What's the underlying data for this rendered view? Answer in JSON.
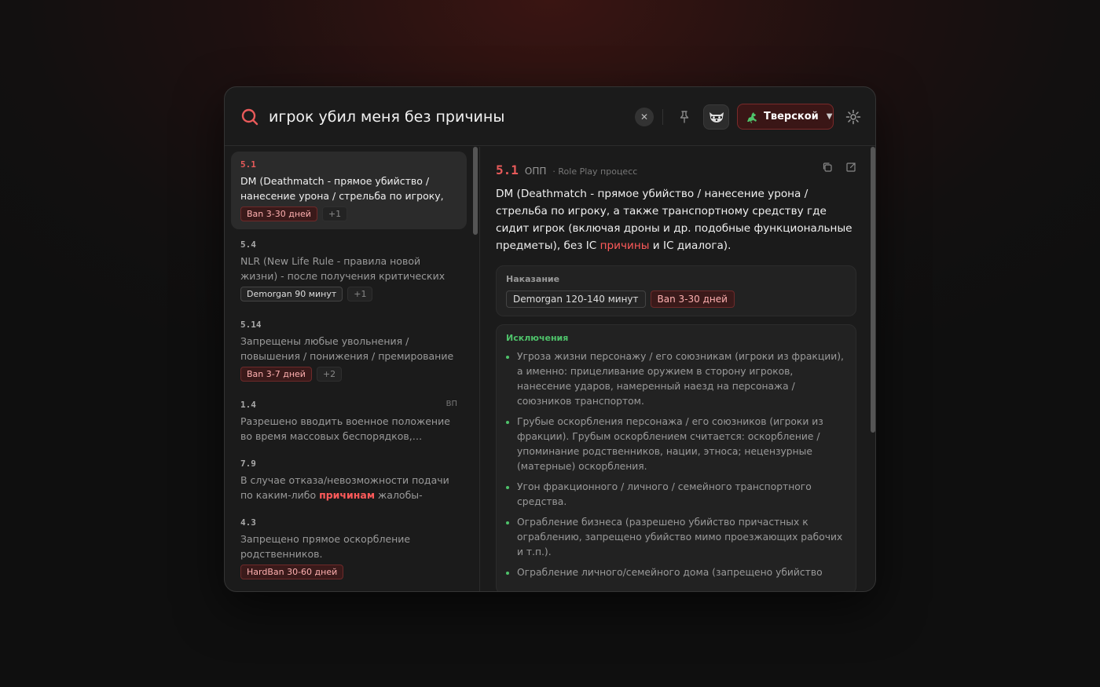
{
  "search": {
    "query": "игрок убил меня без причины",
    "server_label": "Тверской"
  },
  "results": [
    {
      "code": "5.1",
      "title": "DM (Deathmatch - прямое убийство / нанесение урона / стрельба по игроку, а…",
      "badges": [
        "Ban 3-30 дней"
      ],
      "more": "+1",
      "tag": ""
    },
    {
      "code": "5.4",
      "title": "NLR (New Life Rule - правила новой жизни) - после получения критических повреждени…",
      "badges": [
        "Demorgan 90 минут"
      ],
      "more": "+1",
      "tag": ""
    },
    {
      "code": "5.14",
      "title": "Запрещены любые увольнения / повышения / понижения / премирование / снятие /…",
      "badges": [
        "Ban 3-7 дней"
      ],
      "more": "+2",
      "tag": ""
    },
    {
      "code": "1.4",
      "title": "Разрешено вводить военное положение во время массовых беспорядков,…",
      "badges": [],
      "more": "",
      "tag": "ВП"
    },
    {
      "code": "7.9",
      "title_pre": "В случае отказа/невозможности подачи по каким-либо ",
      "title_hl": "причинам",
      "title_post": " жалобы-обращения…",
      "badges": [],
      "more": "",
      "tag": ""
    },
    {
      "code": "4.3",
      "title": "Запрещено прямое оскорбление родственников.",
      "badges": [
        "HardBan 30-60 дней"
      ],
      "more": "",
      "tag": ""
    }
  ],
  "detail": {
    "code": "5.1",
    "category": "ОПП",
    "subcategory": "· Role Play процесс",
    "text_pre": "DM (Deathmatch - прямое убийство / нанесение урона / стрельба по игроку, а также транспортному средству где сидит игрок (включая дроны и др. подобные функциональные предметы), без IC ",
    "text_hl": "причины",
    "text_post": " и IC диалога).",
    "punishment_title": "Наказание",
    "punishments": [
      "Demorgan 120-140 минут",
      "Ban 3-30 дней"
    ],
    "exceptions_title": "Исключения",
    "exceptions": [
      "Угроза жизни персонажу / его союзникам (игроки из фракции), а именно: прицеливание оружием в сторону игроков, нанесение ударов, намеренный наезд на персонажа / союзников транспортом.",
      "Грубые оскорбления персонажа / его союзников (игроки из фракции). Грубым оскорблением считается: оскорбление / упоминание родственников, нации, этноса; нецензурные (матерные) оскорбления.",
      "Угон фракционного / личного / семейного транспортного средства.",
      "Ограбление бизнеса (разрешено убийство причастных к ограблению, запрещено убийство мимо проезжающих рабочих и т.п.).",
      "Ограбление личного/семейного дома (запрещено убийство"
    ]
  },
  "icons": {
    "search": "search-icon",
    "clear": "close-icon",
    "pin": "pin-icon",
    "avatar": "raccoon-icon",
    "server": "horse-rider-icon",
    "settings": "gear-icon",
    "copy": "copy-icon",
    "open": "external-link-icon"
  },
  "colors": {
    "accent": "#e85a5a",
    "green": "#4ec26a"
  }
}
